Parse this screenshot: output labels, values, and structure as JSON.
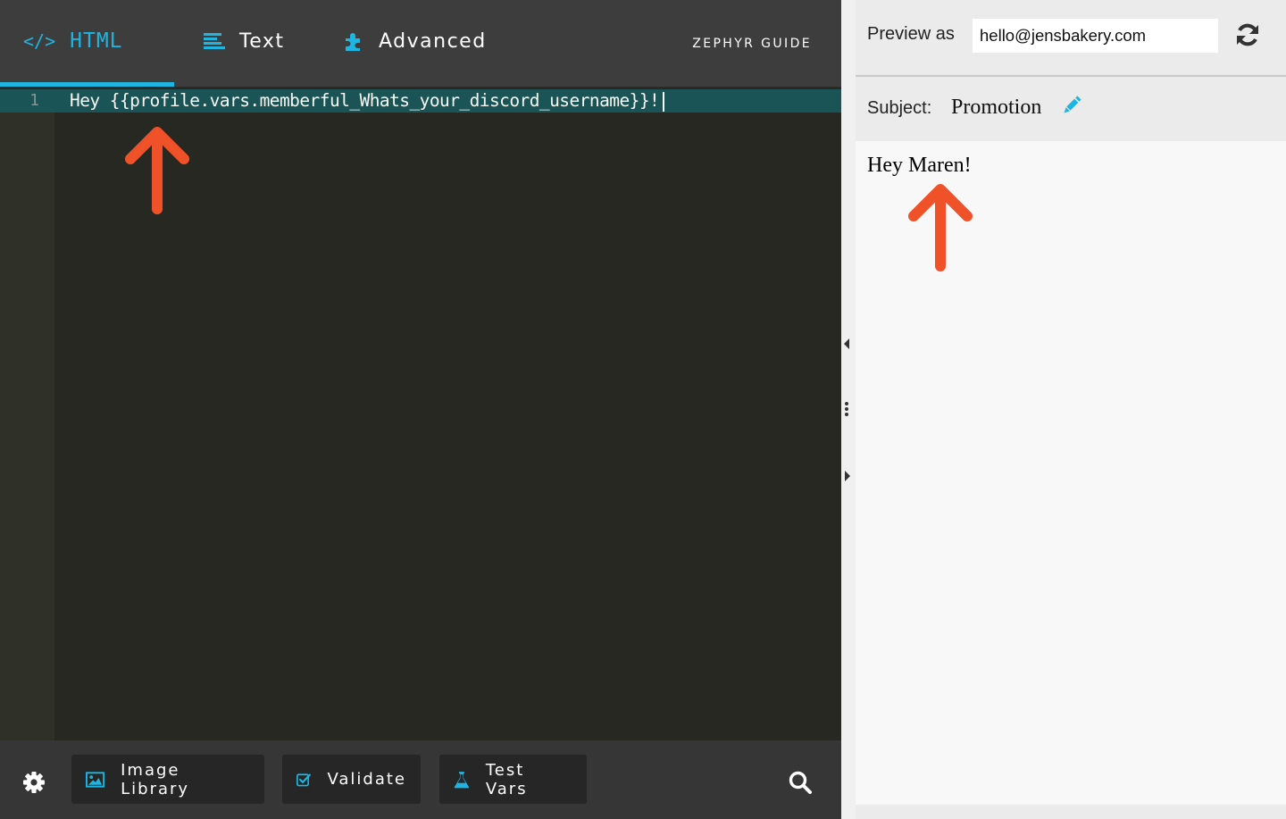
{
  "editor": {
    "tabs": [
      {
        "icon": "code-icon",
        "icon_text": "</>",
        "label": "HTML",
        "active": true
      },
      {
        "icon": "text-lines-icon",
        "label": "Text",
        "active": false
      },
      {
        "icon": "puzzle-icon",
        "label": "Advanced",
        "active": false
      }
    ],
    "guide_link": "ZEPHYR GUIDE",
    "lines": [
      {
        "number": "1",
        "code": "Hey {{profile.vars.memberful_Whats_your_discord_username}}!"
      }
    ]
  },
  "toolbar": {
    "settings_icon": "gear-icon",
    "image_library": "Image Library",
    "validate": "Validate",
    "test_vars": "Test Vars",
    "search_icon": "search-icon"
  },
  "preview": {
    "preview_as_label": "Preview as",
    "preview_as_value": "hello@jensbakery.com",
    "subject_label": "Subject:",
    "subject_value": "Promotion",
    "body_text": "Hey Maren!"
  },
  "colors": {
    "accent": "#1fb5e3",
    "arrow": "#ef5228",
    "editor_bg": "#272822",
    "active_line": "#1a5457"
  }
}
